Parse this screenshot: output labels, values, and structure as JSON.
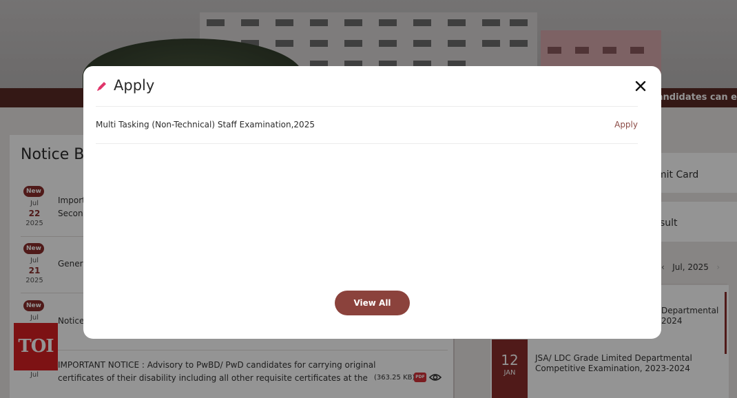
{
  "background": {
    "marquee_text": ", candidates can e",
    "notice_board_title": "Notice Bo",
    "notices": [
      {
        "badge": "New",
        "month": "Jul",
        "day": "22",
        "year": "2025",
        "text_line1": "Import",
        "text_line2": "Secono"
      },
      {
        "badge": "New",
        "month": "Jul",
        "day": "21",
        "year": "2025",
        "text_line1": "Genera",
        "text_line2": ""
      },
      {
        "badge": "New",
        "month": "Jul",
        "day": "",
        "year": "",
        "text_line1": "Notice",
        "text_line2": ""
      },
      {
        "badge": "",
        "month": "Jul",
        "day": "",
        "year": "",
        "text_line1": "IMPORTANT NOTICE : Advisory to PwBD/ PwD candidates for carrying original",
        "text_line2": "certificates of their disability including all other requisite certificates at the",
        "file_size": "(363.25 KB)",
        "file_type": "PDF"
      }
    ],
    "cards": [
      "mit Card",
      "sult"
    ],
    "calendar_month": "Jul, 2025",
    "events": [
      {
        "line1": "Departmental",
        "line2": "2024"
      },
      {
        "date_num": "12",
        "date_mon": "JAN",
        "line1": "JSA/ LDC Grade Limited Departmental",
        "line2": "Competitive Examination, 2023-2024"
      }
    ],
    "watermark": "TOI",
    "accent_color": "#8b2e2b"
  },
  "modal": {
    "title": "Apply",
    "title_icon": "pencil-icon",
    "close_icon": "close-icon",
    "rows": [
      {
        "exam": "Multi Tasking (Non-Technical) Staff Examination,2025",
        "action": "Apply"
      }
    ],
    "view_all_label": "View All",
    "button_color": "#8b423c"
  }
}
